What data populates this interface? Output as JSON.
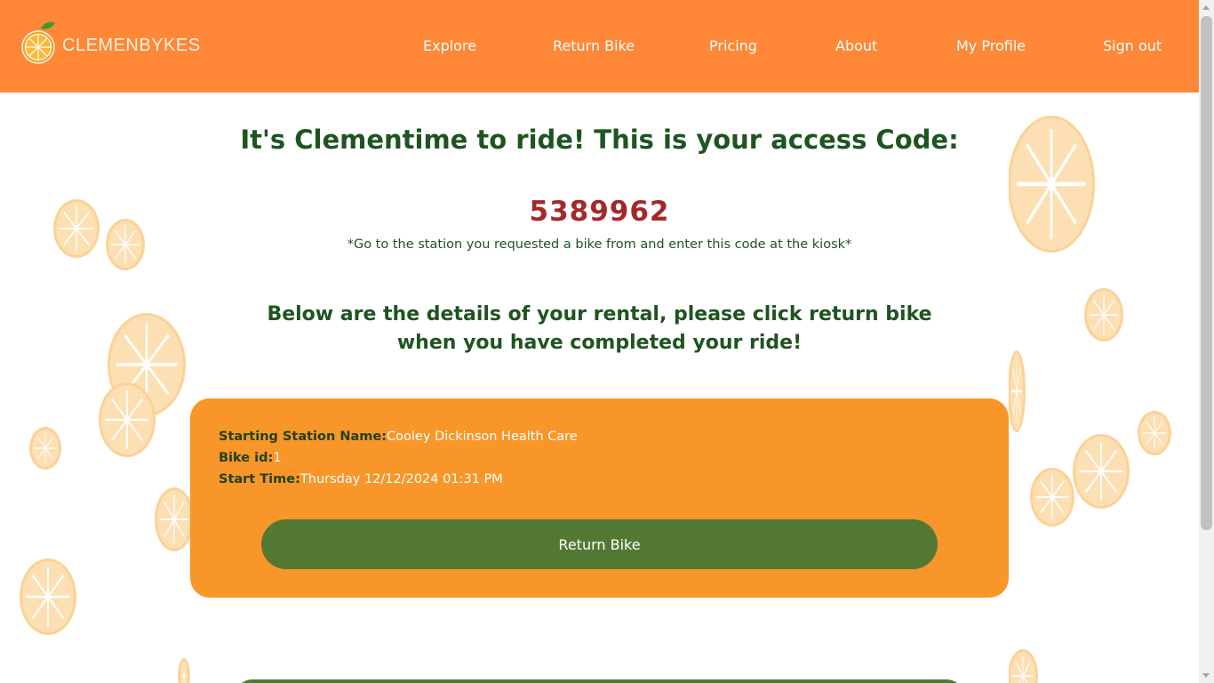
{
  "app": {
    "brand": "CLEMENBYKES",
    "colors": {
      "header": "#fe8738",
      "title_green": "#1f5420",
      "code_red": "#a3282a",
      "card_orange": "#f8962a",
      "button_green": "#537834"
    }
  },
  "nav": {
    "items": [
      {
        "label": "Explore"
      },
      {
        "label": "Return Bike"
      },
      {
        "label": "Pricing"
      },
      {
        "label": "About"
      },
      {
        "label": "My Profile"
      },
      {
        "label": "Sign out"
      }
    ]
  },
  "main": {
    "title": "It's Clementime to ride! This is your access Code:",
    "access_code": "5389962",
    "code_note": "*Go to the station you requested a bike from and enter this code at the kiosk*",
    "details_heading": "Below are the details of your rental, please click return bike when you have completed your ride!"
  },
  "rental": {
    "station_label": "Starting Station Name:",
    "station_value": "Cooley Dickinson Health Care",
    "bike_label": "Bike id:",
    "bike_value": "1",
    "time_label": "Start Time:",
    "time_value": "Thursday 12/12/2024 01:31 PM",
    "return_button": "Return Bike"
  },
  "icons": {
    "logo": "orange-logo-icon",
    "background": "orange-slice-icon"
  }
}
